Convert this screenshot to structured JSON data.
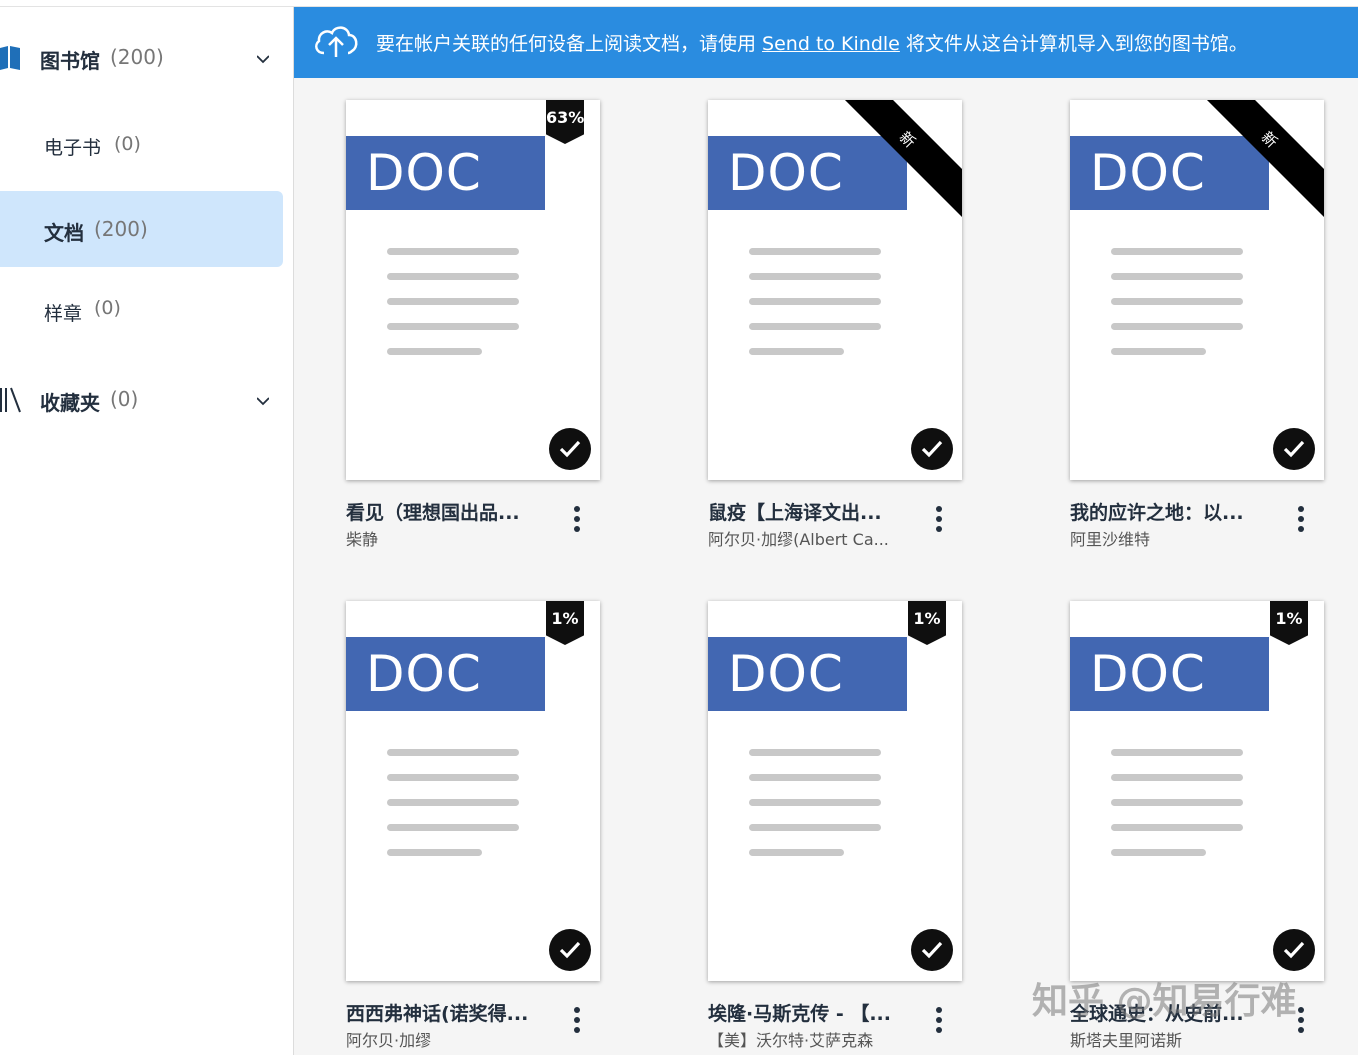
{
  "sidebar": {
    "library": {
      "label": "图书馆",
      "count": "(200)"
    },
    "ebooks": {
      "label": "电子书",
      "count": "(0)"
    },
    "docs": {
      "label": "文档",
      "count": "(200)"
    },
    "samples": {
      "label": "样章",
      "count": "(0)"
    },
    "collections": {
      "label": "收藏夹",
      "count": "(0)"
    }
  },
  "banner": {
    "text_before": "要在帐户关联的任何设备上阅读文档，请使用 ",
    "link": "Send to Kindle",
    "text_after": " 将文件从这台计算机导入到您的图书馆。"
  },
  "doc_label": "DOC",
  "items": [
    {
      "title": "看见（理想国出品...",
      "author": "柴静",
      "badge": "63%"
    },
    {
      "title": "鼠疫【上海译文出...",
      "author": "阿尔贝·加缪(Albert Ca...",
      "badge": "新"
    },
    {
      "title": "我的应许之地：以...",
      "author": "阿里沙维特",
      "badge": "新"
    },
    {
      "title": "西西弗神话(诺奖得...",
      "author": "阿尔贝·加缪",
      "badge": "1%"
    },
    {
      "title": "埃隆·马斯克传 - 【...",
      "author": "【美】沃尔特·艾萨克森",
      "badge": "1%"
    },
    {
      "title": "全球通史：从史前...",
      "author": "斯塔夫里阿诺斯",
      "badge": "1%"
    }
  ],
  "watermark": "知乎 @知易行难",
  "colors": {
    "banner": "#2a8ce0",
    "doc_band": "#4267b2",
    "selected": "#cfe6fc"
  }
}
